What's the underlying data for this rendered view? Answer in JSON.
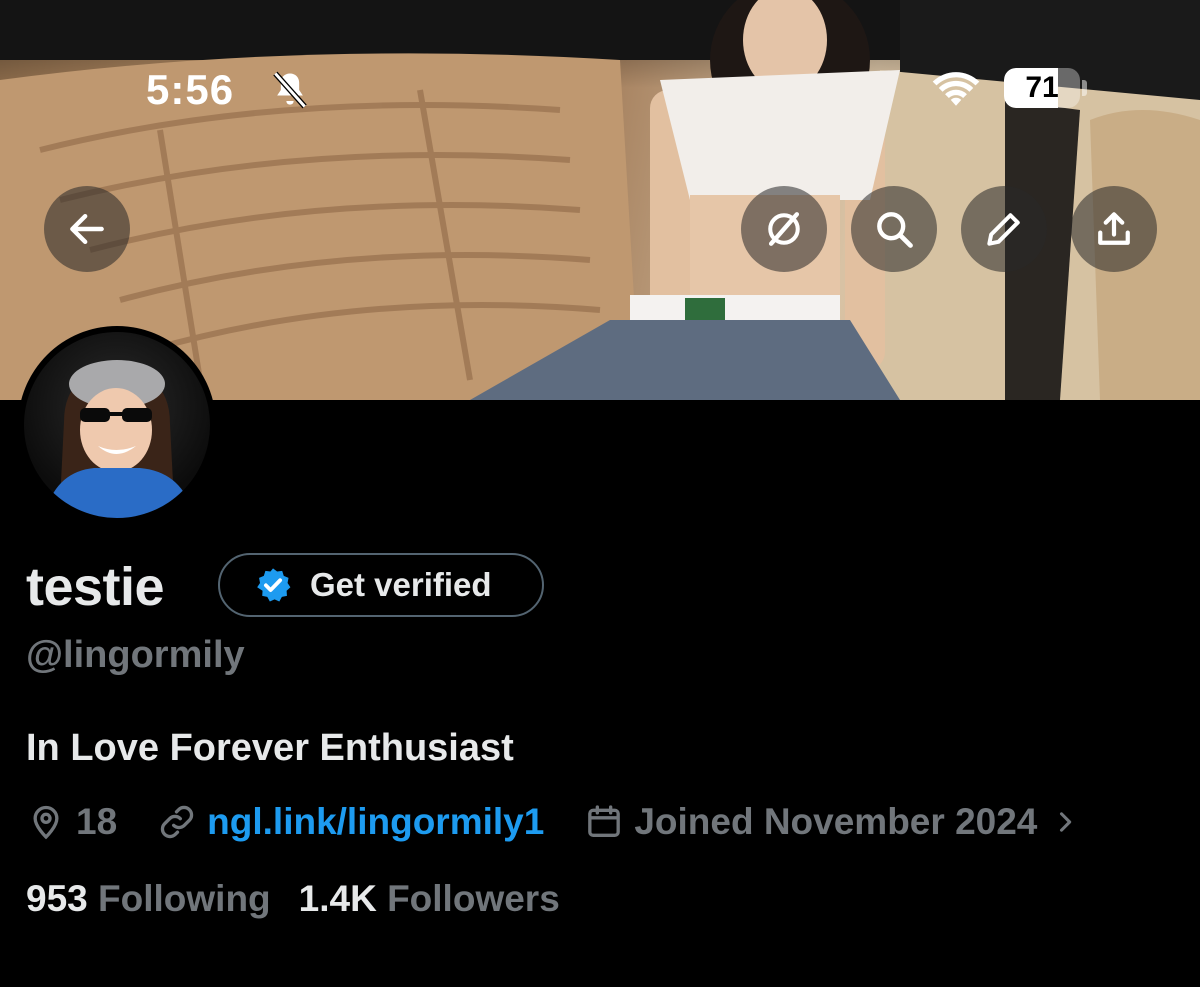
{
  "status_bar": {
    "time": "5:56",
    "silent_icon": "bell-slash-icon",
    "wifi_icon": "wifi-icon",
    "battery_level": "71",
    "battery_fraction": 0.71
  },
  "banner": {
    "back_icon": "arrow-left-icon",
    "actions": [
      {
        "icon": "grok-icon"
      },
      {
        "icon": "search-icon"
      },
      {
        "icon": "pencil-icon"
      },
      {
        "icon": "share-icon"
      }
    ]
  },
  "profile": {
    "display_name": "testie",
    "get_verified_label": "Get verified",
    "handle": "@lingormily",
    "bio": "In Love Forever Enthusiast",
    "location": "18",
    "link": "ngl.link/lingormily1",
    "joined": "Joined November 2024",
    "following_count": "953",
    "following_label": "Following",
    "followers_count": "1.4K",
    "followers_label": "Followers"
  },
  "colors": {
    "background": "#000000",
    "primary_text": "#e7e9ea",
    "secondary_text": "#71767b",
    "link": "#1d9bf0",
    "verified_badge": "#1d9bf0"
  }
}
